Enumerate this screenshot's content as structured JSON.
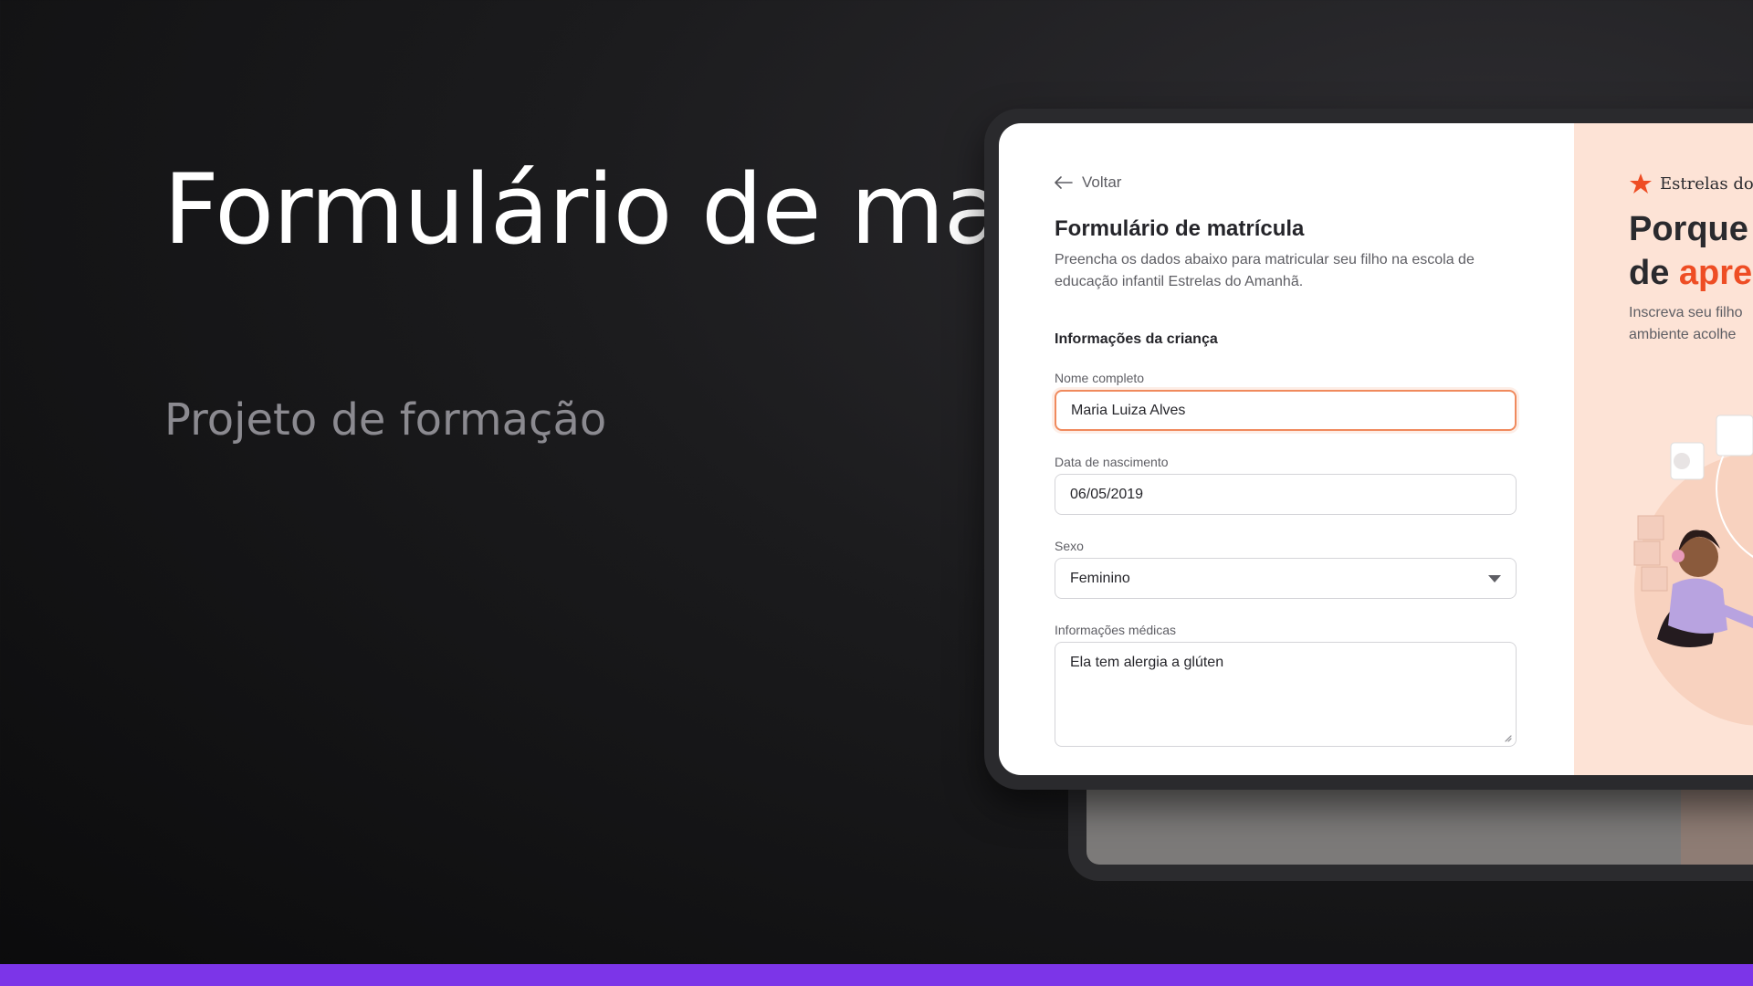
{
  "hero": {
    "title": "Formulário de matrícula",
    "subtitle": "Projeto de formação"
  },
  "form": {
    "back_label": "Voltar",
    "title": "Formulário de matrícula",
    "description": "Preencha os dados abaixo para matricular seu filho na escola de educação infantil Estrelas do Amanhã.",
    "section_title": "Informações da criança",
    "fields": {
      "name": {
        "label": "Nome completo",
        "value": "Maria Luiza Alves"
      },
      "birthdate": {
        "label": "Data de nascimento",
        "value": "06/05/2019"
      },
      "sex": {
        "label": "Sexo",
        "value": "Feminino"
      },
      "medical": {
        "label": "Informações médicas",
        "value": "Ela tem alergia a glúten"
      }
    }
  },
  "promo": {
    "brand": "Estrelas do",
    "heading_line1": "Porque",
    "heading_line2_prefix": "de ",
    "heading_line2_accent": "apre",
    "text_line1": "Inscreva seu filho",
    "text_line2": "ambiente acolhe"
  },
  "colors": {
    "accent": "#7c35e8",
    "focus_border": "#f08a5d",
    "promo_bg": "#fde3d6",
    "promo_accent": "#ee4d24"
  },
  "icons": [
    "arrow-left-icon",
    "chevron-down-icon",
    "resize-handle-icon",
    "star-logo-icon"
  ]
}
